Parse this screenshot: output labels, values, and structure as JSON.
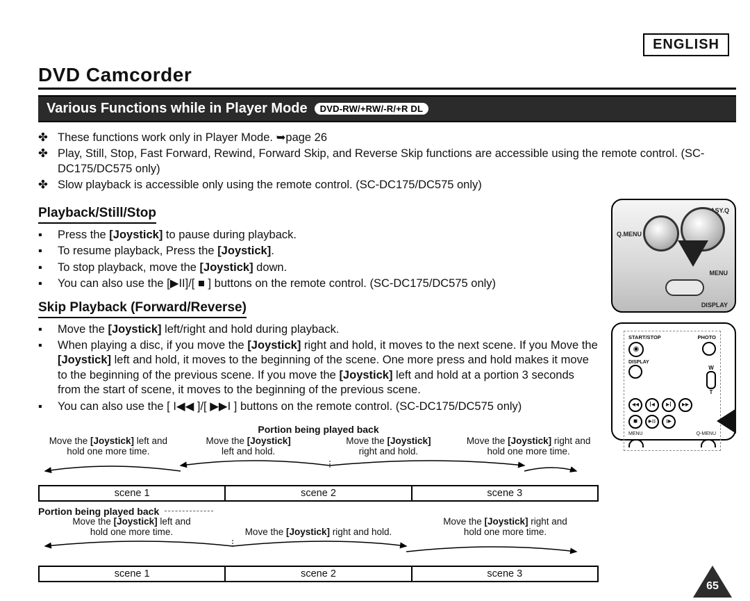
{
  "language_label": "ENGLISH",
  "title": "DVD Camcorder",
  "banner": {
    "text": "Various Functions while in Player Mode",
    "formats": "DVD-RW/+RW/-R/+R DL"
  },
  "top_bullets": [
    "These functions work only in Player Mode. ➥page 26",
    "Play, Still, Stop, Fast Forward, Rewind, Forward Skip, and Reverse Skip functions are accessible using the remote control. (SC-DC175/DC575 only)",
    "Slow playback is accessible only using the remote control. (SC-DC175/DC575 only)"
  ],
  "sections": {
    "playback_heading": "Playback/Still/Stop",
    "playback_bullets": [
      "Press the [Joystick] to pause during playback.",
      "To resume playback, Press the [Joystick].",
      "To stop playback, move the [Joystick] down.",
      "You can also use the [▶II]/[ ■ ] buttons on the remote control. (SC-DC175/DC575 only)"
    ],
    "skip_heading": "Skip Playback (Forward/Reverse)",
    "skip_bullets": [
      "Move the [Joystick] left/right and hold during playback.",
      "When playing a disc, if you move the [Joystick] right and hold, it moves to the next scene. If you Move the [Joystick] left and hold, it moves to the beginning of the scene. One more press and hold makes it move to the beginning of the previous scene. If you move the [Joystick] left and hold at a portion 3 seconds from the start of scene, it moves to the beginning of the previous scene.",
      "You can also use the [ I◀◀ ]/[ ▶▶I ] buttons on the remote control. (SC-DC175/DC575 only)"
    ]
  },
  "illus_labels": {
    "easyq": "EASY.Q",
    "qmenu": "Q.MENU",
    "menu": "MENU",
    "display": "DISPLAY"
  },
  "remote_labels": {
    "startstop": "START/STOP",
    "photo": "PHOTO",
    "display": "DISPLAY",
    "w": "W",
    "t": "T",
    "menu": "MENU",
    "qmenu": "Q-MENU"
  },
  "diagram": {
    "caption": "Portion being played back",
    "cells_top": [
      "Move the [Joystick] left and\nhold one more time.",
      "Move the [Joystick]\nleft and hold.",
      "Move the [Joystick]\nright and hold.",
      "Move the [Joystick] right and\nhold one more time."
    ],
    "scenes": [
      "scene 1",
      "scene 2",
      "scene 3"
    ],
    "caption2_left": "Portion being played back",
    "cells_bottom": [
      "Move the [Joystick] left and\nhold one more time.",
      "Move the [Joystick] right and hold.",
      "Move the [Joystick] right and\nhold one more time."
    ]
  },
  "page_number": "65"
}
